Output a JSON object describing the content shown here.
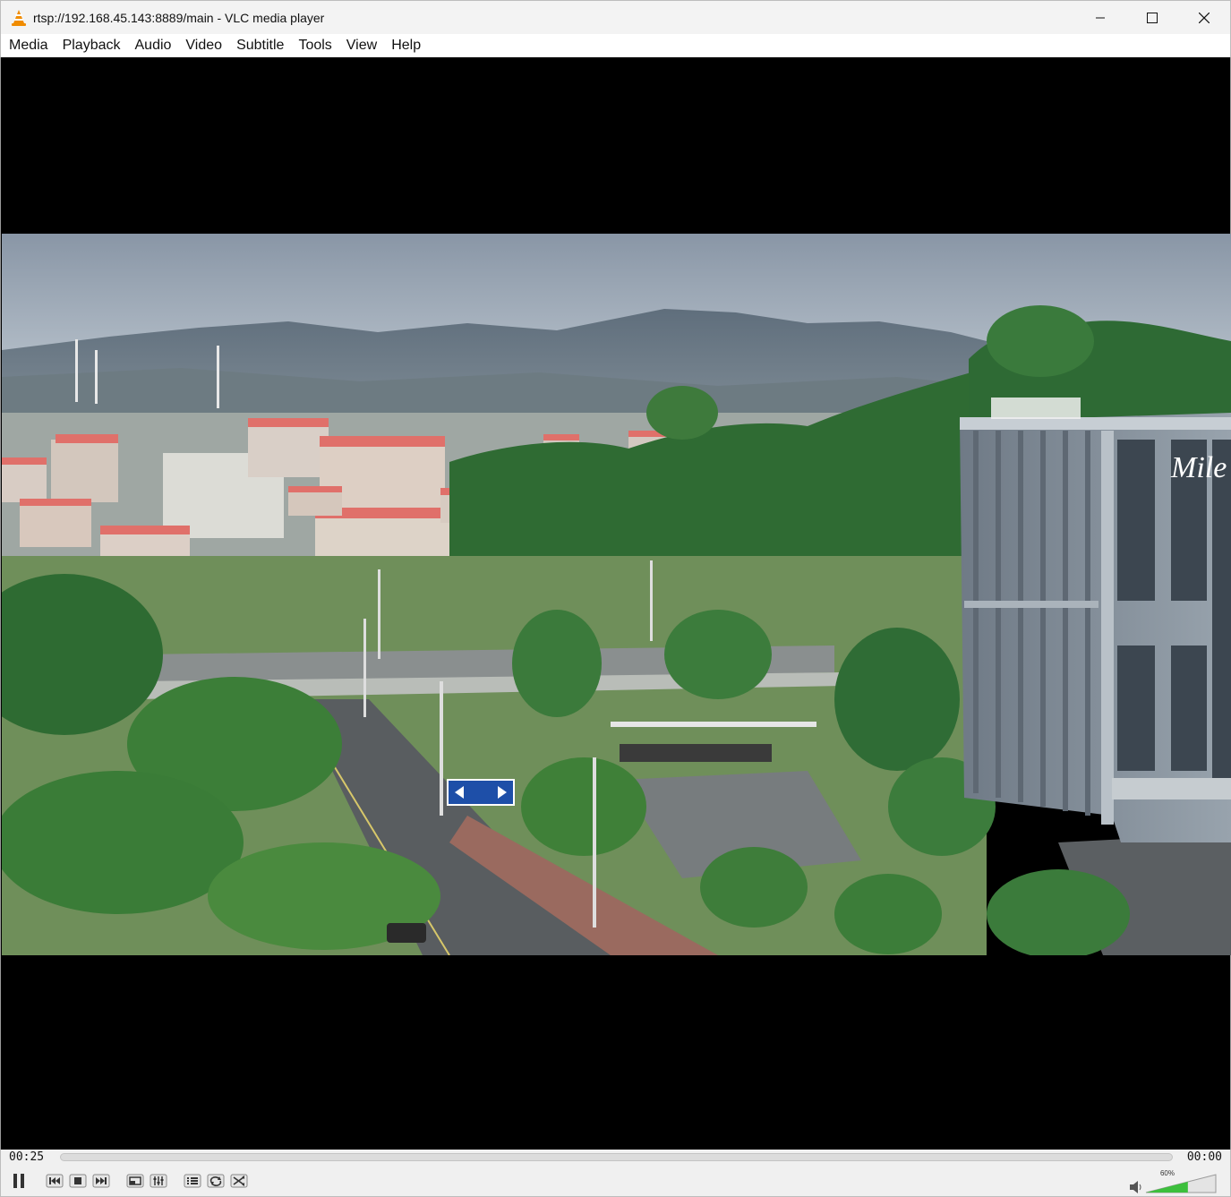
{
  "window": {
    "title": "rtsp://192.168.45.143:8889/main - VLC media player"
  },
  "menu": [
    {
      "label": "Media"
    },
    {
      "label": "Playback"
    },
    {
      "label": "Audio"
    },
    {
      "label": "Video"
    },
    {
      "label": "Subtitle"
    },
    {
      "label": "Tools"
    },
    {
      "label": "View"
    },
    {
      "label": "Help"
    }
  ],
  "playback": {
    "elapsed": "00:25",
    "total": "00:00",
    "volume_label": "60%",
    "volume_level": 0.6,
    "seek_position": 0
  },
  "video": {
    "building_sign": "Mile"
  },
  "colors": {
    "vlc_orange": "#f08c00",
    "volume_green": "#3cbf3c",
    "roof_red": "#e0706a",
    "tree_green": "#2f6b33"
  },
  "icons": {
    "app": "vlc-cone-icon",
    "minimize": "minimize-icon",
    "maximize": "maximize-icon",
    "close": "close-icon",
    "pause": "pause-icon",
    "previous": "previous-icon",
    "stop": "stop-icon",
    "next": "next-icon",
    "fullscreen": "fullscreen-icon",
    "extended": "extended-settings-icon",
    "playlist": "playlist-icon",
    "loop": "loop-icon",
    "shuffle": "shuffle-icon",
    "speaker": "speaker-icon"
  }
}
